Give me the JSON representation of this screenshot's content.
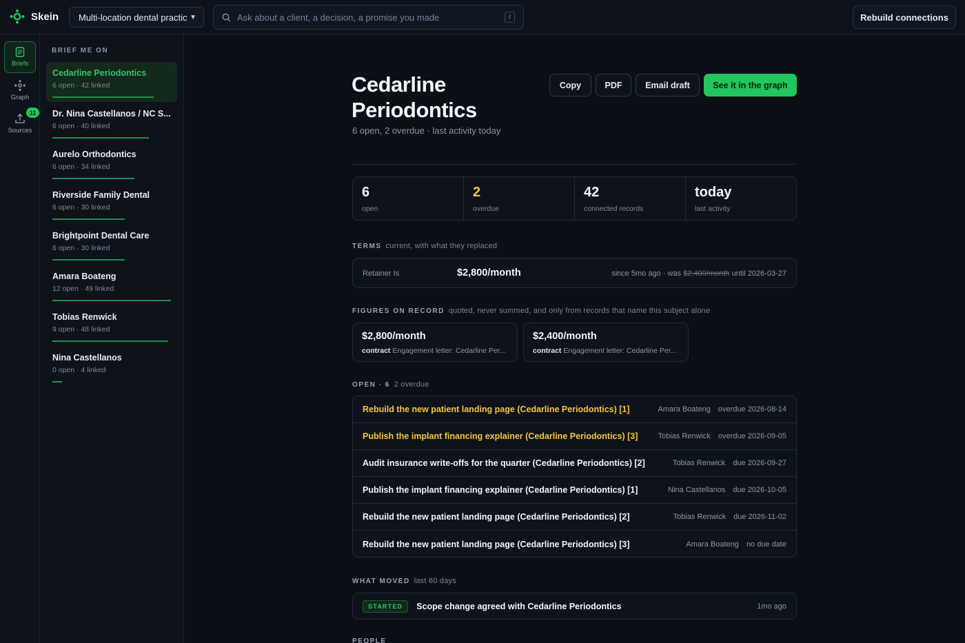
{
  "app": {
    "name": "Skein"
  },
  "workspace": {
    "selected": "Multi-location dental practice"
  },
  "search": {
    "placeholder": "Ask about a client, a decision, a promise you made",
    "shortcut": "/"
  },
  "topbar": {
    "rebuild_label": "Rebuild connections"
  },
  "rail": {
    "items": [
      {
        "label": "Briefs",
        "icon": "document-icon"
      },
      {
        "label": "Graph",
        "icon": "graph-icon"
      },
      {
        "label": "Sources",
        "icon": "upload-icon",
        "badge": "11"
      }
    ]
  },
  "sidebar": {
    "title": "BRIEF ME ON",
    "items": [
      {
        "name": "Cedarline Periodontics",
        "meta": "6 open · 42 linked",
        "weight": 0.42
      },
      {
        "name": "Dr. Nina Castellanos / NC S...",
        "meta": "6 open · 40 linked",
        "weight": 0.4
      },
      {
        "name": "Aurelo Orthodontics",
        "meta": "6 open · 34 linked",
        "weight": 0.34
      },
      {
        "name": "Riverside Family Dental",
        "meta": "6 open · 30 linked",
        "weight": 0.3
      },
      {
        "name": "Brightpoint Dental Care",
        "meta": "6 open · 30 linked",
        "weight": 0.3
      },
      {
        "name": "Amara Boateng",
        "meta": "12 open · 49 linked",
        "weight": 0.49
      },
      {
        "name": "Tobias Renwick",
        "meta": "9 open · 48 linked",
        "weight": 0.48
      },
      {
        "name": "Nina Castellanos",
        "meta": "0 open · 4 linked",
        "weight": 0.04
      }
    ]
  },
  "main": {
    "title_line1": "Cedarline",
    "title_line2": "Periodontics",
    "subtitle": "6 open, 2 overdue · last activity today",
    "buttons": {
      "copy": "Copy",
      "pdf": "PDF",
      "email": "Email draft",
      "graph": "See it in the graph"
    },
    "stats": [
      {
        "value": "6",
        "label": "open"
      },
      {
        "value": "2",
        "label": "overdue"
      },
      {
        "value": "42",
        "label": "connected records"
      },
      {
        "value": "today",
        "label": "last activity"
      }
    ],
    "terms": {
      "heading": "TERMS",
      "note": "current, with what they replaced",
      "label": "Retainer Is",
      "value": "$2,800/month",
      "since_prefix": "since 5mo ago · was",
      "was": "$2,400/month",
      "until": "until 2026-03-27"
    },
    "figures": {
      "heading": "FIGURES ON RECORD",
      "note": "quoted, never summed, and only from records that name this subject alone",
      "items": [
        {
          "value": "$2,800/month",
          "kind": "contract",
          "source": "Engagement letter: Cedarline Per..."
        },
        {
          "value": "$2,400/month",
          "kind": "contract",
          "source": "Engagement letter: Cedarline Per..."
        }
      ]
    },
    "open": {
      "heading": "OPEN · 6",
      "note": "2 overdue",
      "rows": [
        {
          "title": "Rebuild the new patient landing page (Cedarline Periodontics) [1]",
          "owner": "Amara Boateng",
          "due": "overdue 2026-08-14"
        },
        {
          "title": "Publish the implant financing explainer (Cedarline Periodontics) [3]",
          "owner": "Tobias Renwick",
          "due": "overdue 2026-09-05"
        },
        {
          "title": "Audit insurance write-offs for the quarter (Cedarline Periodontics) [2]",
          "owner": "Tobias Renwick",
          "due": "due 2026-09-27"
        },
        {
          "title": "Publish the implant financing explainer (Cedarline Periodontics) [1]",
          "owner": "Nina Castellanos",
          "due": "due 2026-10-05"
        },
        {
          "title": "Rebuild the new patient landing page (Cedarline Periodontics) [2]",
          "owner": "Tobias Renwick",
          "due": "due 2026-11-02"
        },
        {
          "title": "Rebuild the new patient landing page (Cedarline Periodontics) [3]",
          "owner": "Amara Boateng",
          "due": "no due date"
        }
      ]
    },
    "moved": {
      "heading": "WHAT MOVED",
      "note": "last 60 days",
      "tag": "STARTED",
      "text": "Scope change agreed with Cedarline Periodontics",
      "time": "1mo ago"
    },
    "people": {
      "heading": "PEOPLE"
    }
  },
  "colors": {
    "accent": "#22c55e",
    "warning": "#f5c443",
    "background": "#0b0f16"
  }
}
